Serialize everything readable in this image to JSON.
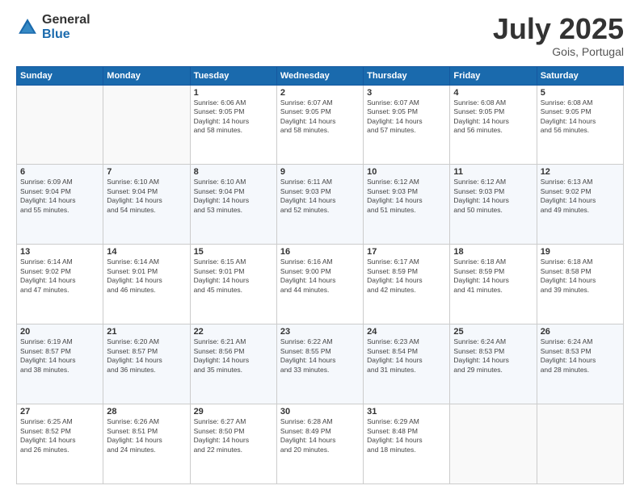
{
  "logo": {
    "general": "General",
    "blue": "Blue"
  },
  "title": "July 2025",
  "location": "Gois, Portugal",
  "days_of_week": [
    "Sunday",
    "Monday",
    "Tuesday",
    "Wednesday",
    "Thursday",
    "Friday",
    "Saturday"
  ],
  "weeks": [
    [
      {
        "day": "",
        "info": ""
      },
      {
        "day": "",
        "info": ""
      },
      {
        "day": "1",
        "sunrise": "6:06 AM",
        "sunset": "9:05 PM",
        "daylight": "14 hours and 58 minutes."
      },
      {
        "day": "2",
        "sunrise": "6:07 AM",
        "sunset": "9:05 PM",
        "daylight": "14 hours and 58 minutes."
      },
      {
        "day": "3",
        "sunrise": "6:07 AM",
        "sunset": "9:05 PM",
        "daylight": "14 hours and 57 minutes."
      },
      {
        "day": "4",
        "sunrise": "6:08 AM",
        "sunset": "9:05 PM",
        "daylight": "14 hours and 56 minutes."
      },
      {
        "day": "5",
        "sunrise": "6:08 AM",
        "sunset": "9:05 PM",
        "daylight": "14 hours and 56 minutes."
      }
    ],
    [
      {
        "day": "6",
        "sunrise": "6:09 AM",
        "sunset": "9:04 PM",
        "daylight": "14 hours and 55 minutes."
      },
      {
        "day": "7",
        "sunrise": "6:10 AM",
        "sunset": "9:04 PM",
        "daylight": "14 hours and 54 minutes."
      },
      {
        "day": "8",
        "sunrise": "6:10 AM",
        "sunset": "9:04 PM",
        "daylight": "14 hours and 53 minutes."
      },
      {
        "day": "9",
        "sunrise": "6:11 AM",
        "sunset": "9:03 PM",
        "daylight": "14 hours and 52 minutes."
      },
      {
        "day": "10",
        "sunrise": "6:12 AM",
        "sunset": "9:03 PM",
        "daylight": "14 hours and 51 minutes."
      },
      {
        "day": "11",
        "sunrise": "6:12 AM",
        "sunset": "9:03 PM",
        "daylight": "14 hours and 50 minutes."
      },
      {
        "day": "12",
        "sunrise": "6:13 AM",
        "sunset": "9:02 PM",
        "daylight": "14 hours and 49 minutes."
      }
    ],
    [
      {
        "day": "13",
        "sunrise": "6:14 AM",
        "sunset": "9:02 PM",
        "daylight": "14 hours and 47 minutes."
      },
      {
        "day": "14",
        "sunrise": "6:14 AM",
        "sunset": "9:01 PM",
        "daylight": "14 hours and 46 minutes."
      },
      {
        "day": "15",
        "sunrise": "6:15 AM",
        "sunset": "9:01 PM",
        "daylight": "14 hours and 45 minutes."
      },
      {
        "day": "16",
        "sunrise": "6:16 AM",
        "sunset": "9:00 PM",
        "daylight": "14 hours and 44 minutes."
      },
      {
        "day": "17",
        "sunrise": "6:17 AM",
        "sunset": "8:59 PM",
        "daylight": "14 hours and 42 minutes."
      },
      {
        "day": "18",
        "sunrise": "6:18 AM",
        "sunset": "8:59 PM",
        "daylight": "14 hours and 41 minutes."
      },
      {
        "day": "19",
        "sunrise": "6:18 AM",
        "sunset": "8:58 PM",
        "daylight": "14 hours and 39 minutes."
      }
    ],
    [
      {
        "day": "20",
        "sunrise": "6:19 AM",
        "sunset": "8:57 PM",
        "daylight": "14 hours and 38 minutes."
      },
      {
        "day": "21",
        "sunrise": "6:20 AM",
        "sunset": "8:57 PM",
        "daylight": "14 hours and 36 minutes."
      },
      {
        "day": "22",
        "sunrise": "6:21 AM",
        "sunset": "8:56 PM",
        "daylight": "14 hours and 35 minutes."
      },
      {
        "day": "23",
        "sunrise": "6:22 AM",
        "sunset": "8:55 PM",
        "daylight": "14 hours and 33 minutes."
      },
      {
        "day": "24",
        "sunrise": "6:23 AM",
        "sunset": "8:54 PM",
        "daylight": "14 hours and 31 minutes."
      },
      {
        "day": "25",
        "sunrise": "6:24 AM",
        "sunset": "8:53 PM",
        "daylight": "14 hours and 29 minutes."
      },
      {
        "day": "26",
        "sunrise": "6:24 AM",
        "sunset": "8:53 PM",
        "daylight": "14 hours and 28 minutes."
      }
    ],
    [
      {
        "day": "27",
        "sunrise": "6:25 AM",
        "sunset": "8:52 PM",
        "daylight": "14 hours and 26 minutes."
      },
      {
        "day": "28",
        "sunrise": "6:26 AM",
        "sunset": "8:51 PM",
        "daylight": "14 hours and 24 minutes."
      },
      {
        "day": "29",
        "sunrise": "6:27 AM",
        "sunset": "8:50 PM",
        "daylight": "14 hours and 22 minutes."
      },
      {
        "day": "30",
        "sunrise": "6:28 AM",
        "sunset": "8:49 PM",
        "daylight": "14 hours and 20 minutes."
      },
      {
        "day": "31",
        "sunrise": "6:29 AM",
        "sunset": "8:48 PM",
        "daylight": "14 hours and 18 minutes."
      },
      {
        "day": "",
        "info": ""
      },
      {
        "day": "",
        "info": ""
      }
    ]
  ]
}
